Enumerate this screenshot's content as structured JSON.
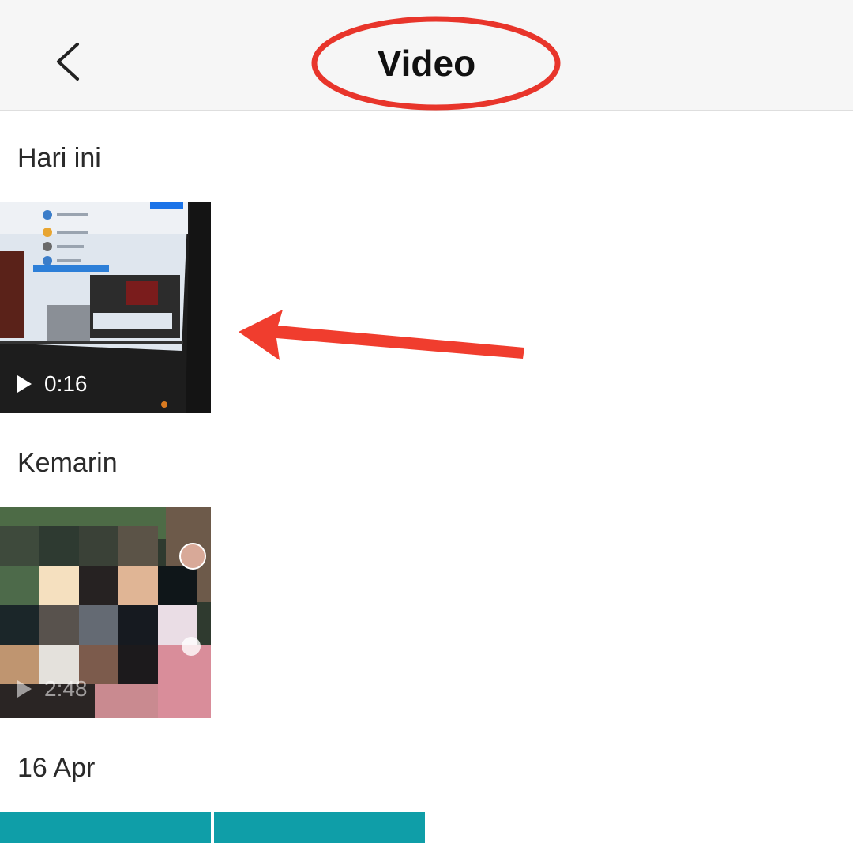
{
  "header": {
    "title": "Video",
    "back_icon": "chevron-left-icon"
  },
  "sections": [
    {
      "label": "Hari ini",
      "videos": [
        {
          "duration": "0:16",
          "play_icon": "play-icon"
        }
      ]
    },
    {
      "label": "Kemarin",
      "videos": [
        {
          "duration": "2:48",
          "play_icon": "play-icon"
        }
      ]
    },
    {
      "label": "16 Apr",
      "videos": [
        {
          "color": "#0f9ea8"
        },
        {
          "color": "#0f9ea8"
        }
      ]
    }
  ],
  "annotations": {
    "highlight_color": "#e8352b"
  }
}
